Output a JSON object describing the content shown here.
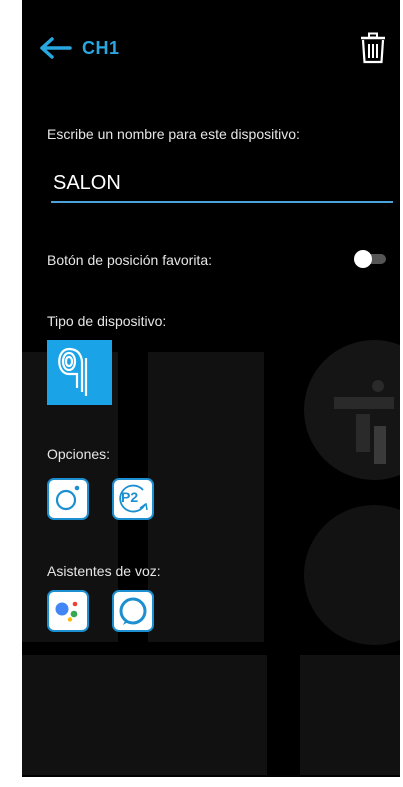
{
  "header": {
    "title": "CH1"
  },
  "name_section": {
    "label": "Escribe un nombre para este dispositivo:",
    "value": "SALON"
  },
  "favorite": {
    "label": "Botón de posición favorita:",
    "enabled": false
  },
  "device_type": {
    "label": "Tipo de dispositivo:",
    "icon": "spiral-device-icon",
    "color": "#1ba3e8"
  },
  "options": {
    "label": "Opciones:",
    "items": [
      {
        "icon": "circle-dot-icon"
      },
      {
        "icon": "p2-icon",
        "text": "P2"
      }
    ]
  },
  "voice_assistants": {
    "label": "Asistentes de voz:",
    "items": [
      {
        "icon": "google-assistant-icon"
      },
      {
        "icon": "alexa-icon"
      }
    ]
  },
  "colors": {
    "accent": "#29a7e1",
    "underline": "#4aa3d8",
    "border": "#1b8fd0"
  }
}
